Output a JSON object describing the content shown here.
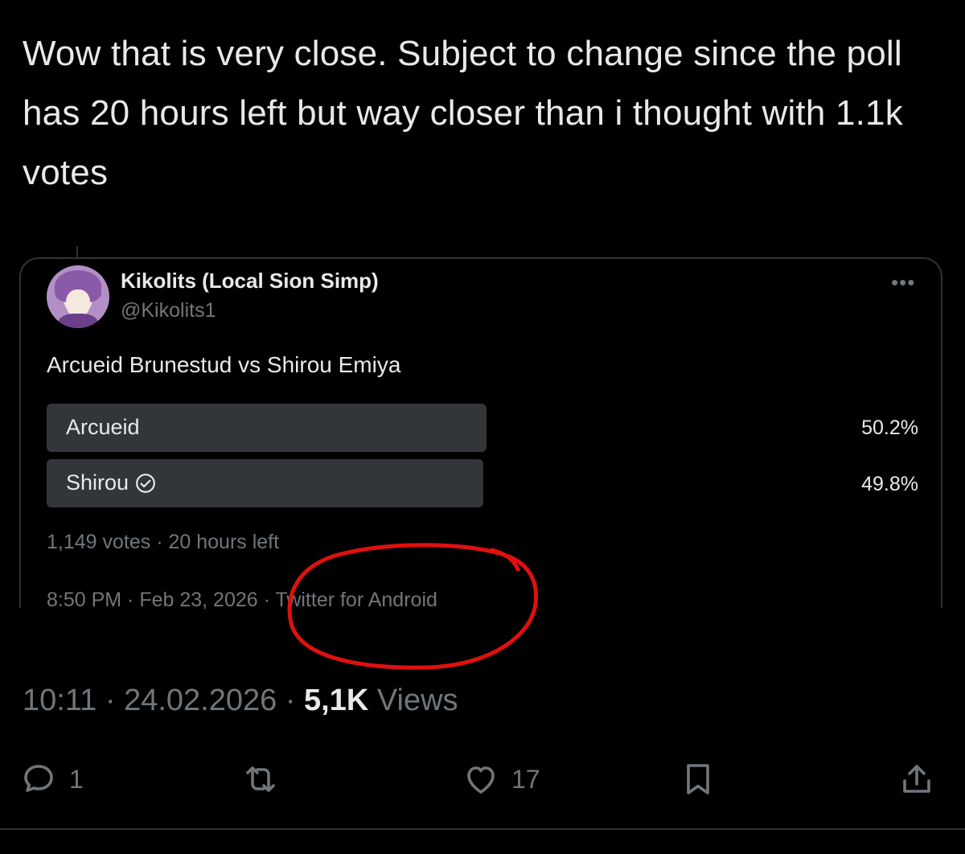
{
  "tweet": {
    "text": "Wow that is very close. Subject to change since the poll has 20 hours left but way closer than i thought with 1.1k votes",
    "time": "10:11",
    "date": "24.02.2026",
    "views_count": "5,1K",
    "views_label": "Views",
    "separator": "·"
  },
  "quote": {
    "display_name": "Kikolits (Local Sion Simp)",
    "handle": "@Kikolits1",
    "more_icon": "more-dots-icon",
    "question": "Arcueid Brunestud vs Shirou Emiya",
    "poll": {
      "options": [
        {
          "label": "Arcueid",
          "percent_text": "50.2%",
          "percent": 50.2,
          "selected": false
        },
        {
          "label": "Shirou",
          "percent_text": "49.8%",
          "percent": 49.8,
          "selected": true
        }
      ],
      "votes_text": "1,149 votes · 20 hours left"
    },
    "timestamp_text": "8:50 PM · Feb 23, 2026 · Twitter for Android"
  },
  "actions": {
    "reply_count": "1",
    "retweet_count": "",
    "like_count": "17"
  },
  "colors": {
    "background": "#000000",
    "text": "#e7e9ea",
    "muted": "#71767b",
    "poll_bar": "#333639",
    "annotation": "#e0100f"
  }
}
